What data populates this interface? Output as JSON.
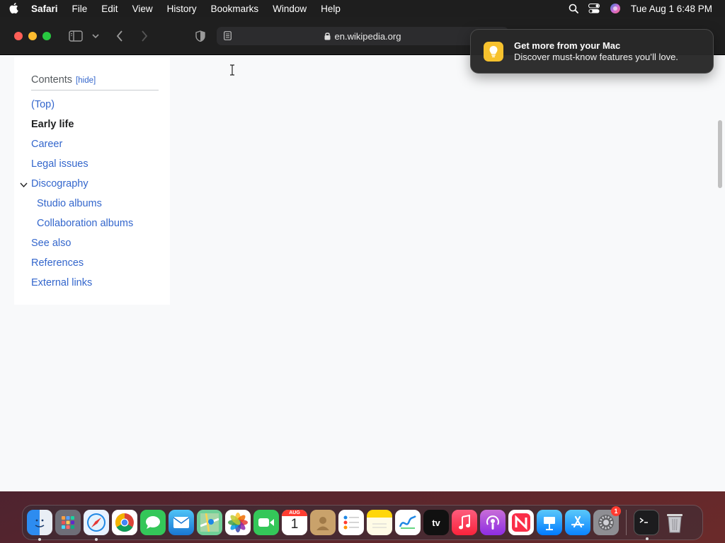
{
  "menubar": {
    "app_name": "Safari",
    "items": [
      "File",
      "Edit",
      "View",
      "History",
      "Bookmarks",
      "Window",
      "Help"
    ],
    "clock": "Tue Aug 1  6:48 PM"
  },
  "browser": {
    "url": "en.wikipedia.org"
  },
  "toc": {
    "title": "Contents",
    "hide_label": "[hide]",
    "items": [
      {
        "label": "(Top)",
        "active": false,
        "sub": false
      },
      {
        "label": "Early life",
        "active": true,
        "sub": false
      },
      {
        "label": "Career",
        "active": false,
        "sub": false
      },
      {
        "label": "Legal issues",
        "active": false,
        "sub": false
      },
      {
        "label": "Discography",
        "active": false,
        "sub": false,
        "expanded": true
      },
      {
        "label": "Studio albums",
        "active": false,
        "sub": true
      },
      {
        "label": "Collaboration albums",
        "active": false,
        "sub": true
      },
      {
        "label": "See also",
        "active": false,
        "sub": false
      },
      {
        "label": "References",
        "active": false,
        "sub": false
      },
      {
        "label": "External links",
        "active": false,
        "sub": false
      }
    ]
  },
  "notification": {
    "title": "Get more from your Mac",
    "body": "Discover must-know features you’ll love."
  },
  "dock": {
    "calendar_month": "AUG",
    "calendar_day": "1",
    "tv_label": "tv",
    "settings_badge": "1"
  },
  "colors": {
    "link": "#3366cc",
    "menubar_bg": "#1e1e1e",
    "toolbar_bg": "#1f1f1f",
    "page_bg": "#f8f9fa"
  }
}
